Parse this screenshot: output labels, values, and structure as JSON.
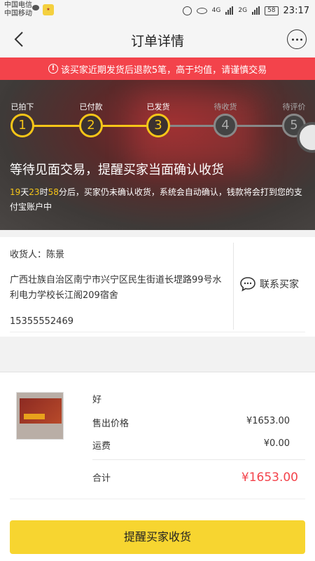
{
  "status_bar": {
    "carrier1": "中国电信",
    "carrier2": "中国移动",
    "network1": "4G",
    "network2": "2G",
    "battery": "58",
    "time": "23:17"
  },
  "nav": {
    "title": "订单详情"
  },
  "warning": {
    "text": "该买家近期发货后退款5笔，高于均值，请谨慎交易"
  },
  "progress": {
    "steps": [
      {
        "label": "已拍下",
        "num": "1",
        "state": "done"
      },
      {
        "label": "已付款",
        "num": "2",
        "state": "done"
      },
      {
        "label": "已发货",
        "num": "3",
        "state": "done"
      },
      {
        "label": "待收货",
        "num": "4",
        "state": "todo"
      },
      {
        "label": "待评价",
        "num": "5",
        "state": "todo"
      }
    ],
    "active_color": "#f5c518",
    "inactive_color": "#888888"
  },
  "hero": {
    "title": "等待见面交易，提醒买家当面确认收货",
    "days": "19",
    "days_unit": "天",
    "hours": "23",
    "hours_unit": "时",
    "minutes": "58",
    "desc_rest": "分后，买家仍未确认收货，系统会自动确认，钱款将会打到您的支付宝账户中"
  },
  "address": {
    "receiver": "收货人：陈景",
    "line": "广西壮族自治区南宁市兴宁区民生街道长堽路99号水利电力学校长江阁209宿舍",
    "phone": "15355552469",
    "contact_label": "联系买家"
  },
  "product": {
    "name": "好",
    "price_label": "售出价格",
    "price_value": "¥1653.00",
    "shipping_label": "运费",
    "shipping_value": "¥0.00",
    "total_label": "合计",
    "total_value": "¥1653.00"
  },
  "footer": {
    "button_label": "提醒买家收货"
  },
  "colors": {
    "accent": "#f7d530",
    "warning": "#f3434b",
    "price": "#f3434b"
  }
}
